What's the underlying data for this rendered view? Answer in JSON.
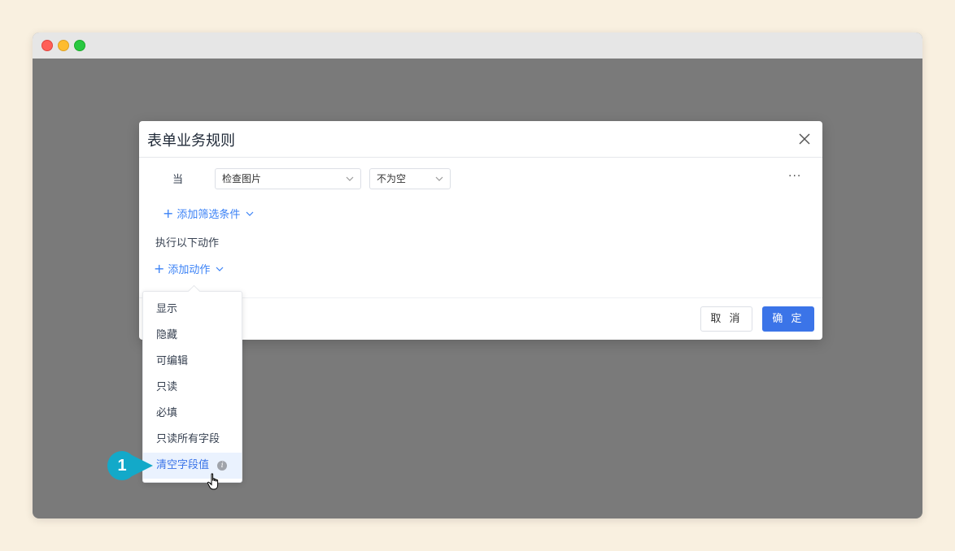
{
  "dialog": {
    "title": "表单业务规则"
  },
  "condition": {
    "when_label": "当",
    "field_value": "检查图片",
    "operator_value": "不为空",
    "more_label": "···"
  },
  "filter": {
    "add_label": "添加筛选条件"
  },
  "actions": {
    "section_label": "执行以下动作",
    "add_label": "添加动作"
  },
  "footer": {
    "cancel_label": "取 消",
    "ok_label": "确 定"
  },
  "menu": {
    "items": [
      {
        "label": "显示"
      },
      {
        "label": "隐藏"
      },
      {
        "label": "可编辑"
      },
      {
        "label": "只读"
      },
      {
        "label": "必填"
      },
      {
        "label": "只读所有字段"
      },
      {
        "label": "清空字段值"
      }
    ],
    "hovered_index": 6
  },
  "callout": {
    "number": "1",
    "color": "#13a9c9"
  },
  "colors": {
    "accent": "#3b74e8",
    "link": "#3b82f6",
    "overlay": "#7a7a7a",
    "page_bg": "#f9f0e0"
  }
}
